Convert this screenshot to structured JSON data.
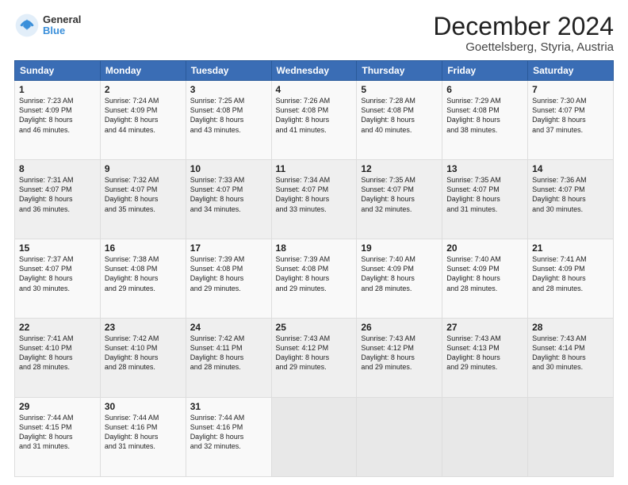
{
  "header": {
    "logo_line1": "General",
    "logo_line2": "Blue",
    "title": "December 2024",
    "subtitle": "Goettelsberg, Styria, Austria"
  },
  "weekdays": [
    "Sunday",
    "Monday",
    "Tuesday",
    "Wednesday",
    "Thursday",
    "Friday",
    "Saturday"
  ],
  "weeks": [
    [
      {
        "day": "1",
        "lines": [
          "Sunrise: 7:23 AM",
          "Sunset: 4:09 PM",
          "Daylight: 8 hours",
          "and 46 minutes."
        ]
      },
      {
        "day": "2",
        "lines": [
          "Sunrise: 7:24 AM",
          "Sunset: 4:09 PM",
          "Daylight: 8 hours",
          "and 44 minutes."
        ]
      },
      {
        "day": "3",
        "lines": [
          "Sunrise: 7:25 AM",
          "Sunset: 4:08 PM",
          "Daylight: 8 hours",
          "and 43 minutes."
        ]
      },
      {
        "day": "4",
        "lines": [
          "Sunrise: 7:26 AM",
          "Sunset: 4:08 PM",
          "Daylight: 8 hours",
          "and 41 minutes."
        ]
      },
      {
        "day": "5",
        "lines": [
          "Sunrise: 7:28 AM",
          "Sunset: 4:08 PM",
          "Daylight: 8 hours",
          "and 40 minutes."
        ]
      },
      {
        "day": "6",
        "lines": [
          "Sunrise: 7:29 AM",
          "Sunset: 4:08 PM",
          "Daylight: 8 hours",
          "and 38 minutes."
        ]
      },
      {
        "day": "7",
        "lines": [
          "Sunrise: 7:30 AM",
          "Sunset: 4:07 PM",
          "Daylight: 8 hours",
          "and 37 minutes."
        ]
      }
    ],
    [
      {
        "day": "8",
        "lines": [
          "Sunrise: 7:31 AM",
          "Sunset: 4:07 PM",
          "Daylight: 8 hours",
          "and 36 minutes."
        ]
      },
      {
        "day": "9",
        "lines": [
          "Sunrise: 7:32 AM",
          "Sunset: 4:07 PM",
          "Daylight: 8 hours",
          "and 35 minutes."
        ]
      },
      {
        "day": "10",
        "lines": [
          "Sunrise: 7:33 AM",
          "Sunset: 4:07 PM",
          "Daylight: 8 hours",
          "and 34 minutes."
        ]
      },
      {
        "day": "11",
        "lines": [
          "Sunrise: 7:34 AM",
          "Sunset: 4:07 PM",
          "Daylight: 8 hours",
          "and 33 minutes."
        ]
      },
      {
        "day": "12",
        "lines": [
          "Sunrise: 7:35 AM",
          "Sunset: 4:07 PM",
          "Daylight: 8 hours",
          "and 32 minutes."
        ]
      },
      {
        "day": "13",
        "lines": [
          "Sunrise: 7:35 AM",
          "Sunset: 4:07 PM",
          "Daylight: 8 hours",
          "and 31 minutes."
        ]
      },
      {
        "day": "14",
        "lines": [
          "Sunrise: 7:36 AM",
          "Sunset: 4:07 PM",
          "Daylight: 8 hours",
          "and 30 minutes."
        ]
      }
    ],
    [
      {
        "day": "15",
        "lines": [
          "Sunrise: 7:37 AM",
          "Sunset: 4:07 PM",
          "Daylight: 8 hours",
          "and 30 minutes."
        ]
      },
      {
        "day": "16",
        "lines": [
          "Sunrise: 7:38 AM",
          "Sunset: 4:08 PM",
          "Daylight: 8 hours",
          "and 29 minutes."
        ]
      },
      {
        "day": "17",
        "lines": [
          "Sunrise: 7:39 AM",
          "Sunset: 4:08 PM",
          "Daylight: 8 hours",
          "and 29 minutes."
        ]
      },
      {
        "day": "18",
        "lines": [
          "Sunrise: 7:39 AM",
          "Sunset: 4:08 PM",
          "Daylight: 8 hours",
          "and 29 minutes."
        ]
      },
      {
        "day": "19",
        "lines": [
          "Sunrise: 7:40 AM",
          "Sunset: 4:09 PM",
          "Daylight: 8 hours",
          "and 28 minutes."
        ]
      },
      {
        "day": "20",
        "lines": [
          "Sunrise: 7:40 AM",
          "Sunset: 4:09 PM",
          "Daylight: 8 hours",
          "and 28 minutes."
        ]
      },
      {
        "day": "21",
        "lines": [
          "Sunrise: 7:41 AM",
          "Sunset: 4:09 PM",
          "Daylight: 8 hours",
          "and 28 minutes."
        ]
      }
    ],
    [
      {
        "day": "22",
        "lines": [
          "Sunrise: 7:41 AM",
          "Sunset: 4:10 PM",
          "Daylight: 8 hours",
          "and 28 minutes."
        ]
      },
      {
        "day": "23",
        "lines": [
          "Sunrise: 7:42 AM",
          "Sunset: 4:10 PM",
          "Daylight: 8 hours",
          "and 28 minutes."
        ]
      },
      {
        "day": "24",
        "lines": [
          "Sunrise: 7:42 AM",
          "Sunset: 4:11 PM",
          "Daylight: 8 hours",
          "and 28 minutes."
        ]
      },
      {
        "day": "25",
        "lines": [
          "Sunrise: 7:43 AM",
          "Sunset: 4:12 PM",
          "Daylight: 8 hours",
          "and 29 minutes."
        ]
      },
      {
        "day": "26",
        "lines": [
          "Sunrise: 7:43 AM",
          "Sunset: 4:12 PM",
          "Daylight: 8 hours",
          "and 29 minutes."
        ]
      },
      {
        "day": "27",
        "lines": [
          "Sunrise: 7:43 AM",
          "Sunset: 4:13 PM",
          "Daylight: 8 hours",
          "and 29 minutes."
        ]
      },
      {
        "day": "28",
        "lines": [
          "Sunrise: 7:43 AM",
          "Sunset: 4:14 PM",
          "Daylight: 8 hours",
          "and 30 minutes."
        ]
      }
    ],
    [
      {
        "day": "29",
        "lines": [
          "Sunrise: 7:44 AM",
          "Sunset: 4:15 PM",
          "Daylight: 8 hours",
          "and 31 minutes."
        ]
      },
      {
        "day": "30",
        "lines": [
          "Sunrise: 7:44 AM",
          "Sunset: 4:16 PM",
          "Daylight: 8 hours",
          "and 31 minutes."
        ]
      },
      {
        "day": "31",
        "lines": [
          "Sunrise: 7:44 AM",
          "Sunset: 4:16 PM",
          "Daylight: 8 hours",
          "and 32 minutes."
        ]
      },
      null,
      null,
      null,
      null
    ]
  ]
}
